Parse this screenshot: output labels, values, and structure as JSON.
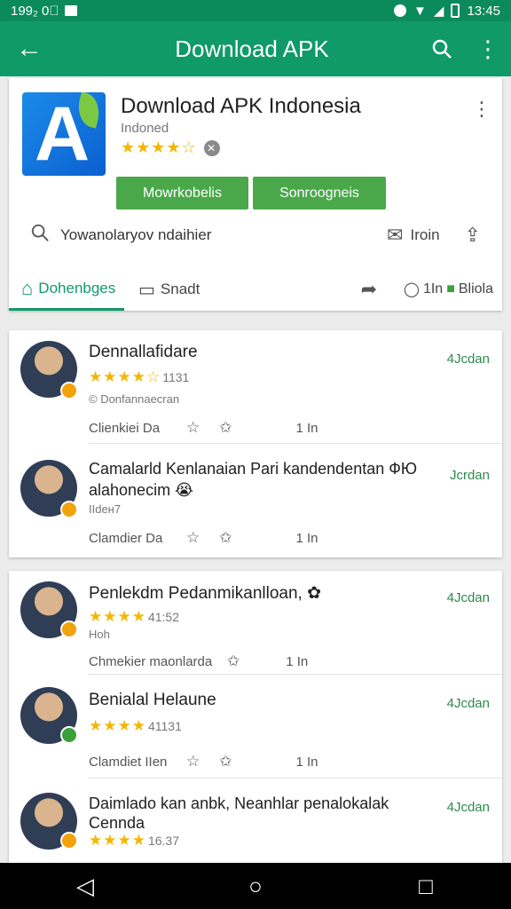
{
  "status": {
    "left_text": "199₂ 0⃣",
    "time": "13:45"
  },
  "app_bar": {
    "title": "Download APK"
  },
  "app": {
    "name": "Download APK Indonesia",
    "developer": "Indoned",
    "stars": "★★★★☆",
    "install_label": "Mowrkobelis",
    "open_label": "Sonroogneis",
    "search_placeholder": "Yowanolaryov ndaihier",
    "mail_label": "Iroin",
    "tab_active": "Dohenbges",
    "tab_second": "Snadt",
    "tab_right": "1In",
    "tab_right_green": "Bliola"
  },
  "reviews_card1": [
    {
      "name": "Dennallafidare",
      "stars": "★★★★☆",
      "count": "1131",
      "meta": "© Donfannaecran",
      "date": "4Jcdan",
      "action_text": "Clienkiei Da",
      "action_count": "1 In"
    },
    {
      "name": "Camalarld Kenlanaian Pari kandendentan ФЮ",
      "name_line2": "alahonecim 😭",
      "meta": "IIdeн7",
      "date": "Jcrdan",
      "action_text": "Clamdier Da",
      "action_count": "1 In"
    }
  ],
  "reviews_card2": [
    {
      "name": "Penlekdm Pedanmikanlloan, ✿",
      "stars": "★★★★",
      "count": "41:52",
      "meta": "Hoh",
      "date": "4Jcdan",
      "action_text": "Chmekier maonlarda",
      "action_count": "1 In"
    },
    {
      "name": "Benialal Helaune",
      "stars": "★★★★",
      "count": "41131",
      "date": "4Jcdan",
      "action_text": "Clamdiet IIen",
      "action_count": "1 In"
    },
    {
      "name": "Daimlado kan anbk, Neanhlar penalokalak",
      "name_line2": "Cennda",
      "stars": "★★★★",
      "count": "16.37",
      "date": "4Jcdan"
    }
  ]
}
